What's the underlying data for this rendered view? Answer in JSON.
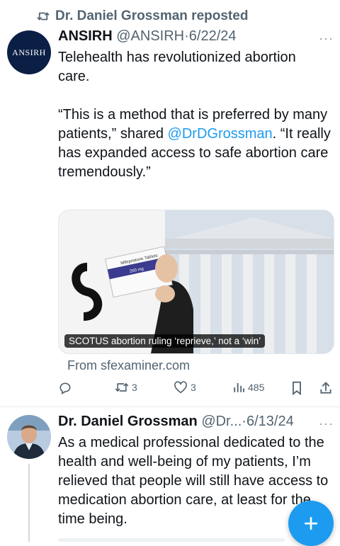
{
  "repost": {
    "label": "Dr. Daniel Grossman reposted"
  },
  "post1": {
    "avatar_text": "ANSIRH",
    "name": "ANSIRH",
    "handle": "@ANSIRH",
    "sep": "·",
    "date": "6/22/24",
    "more": "···",
    "line1": "Telehealth has revolutionized abortion care.",
    "quote_a": "“This is a method that is preferred by many patients,”  shared ",
    "mention": "@DrDGrossman",
    "quote_b": ". “It really has expanded access to safe abortion care tremendously.”",
    "card": {
      "caption": "SCOTUS abortion ruling ‘reprieve,’ not a ‘win’",
      "source": "From sfexaminer.com",
      "box_label": "Mifepristone Tablets",
      "box_dose": "200 mg"
    },
    "actions": {
      "reposts": "3",
      "likes": "3",
      "views": "485"
    }
  },
  "post2": {
    "name": "Dr. Daniel Grossman",
    "handle": "@Dr...",
    "sep": "·",
    "date": "6/13/24",
    "more": "···",
    "text": "As a medical professional dedicated to the health and well-being of my patients, I’m relieved that people will still have access to medication abortion care, at least for the time being."
  },
  "fab": {
    "icon": "plus-icon",
    "label": "+"
  },
  "colors": {
    "accent": "#1d9bf0",
    "muted": "#536471",
    "text": "#0f1419"
  }
}
